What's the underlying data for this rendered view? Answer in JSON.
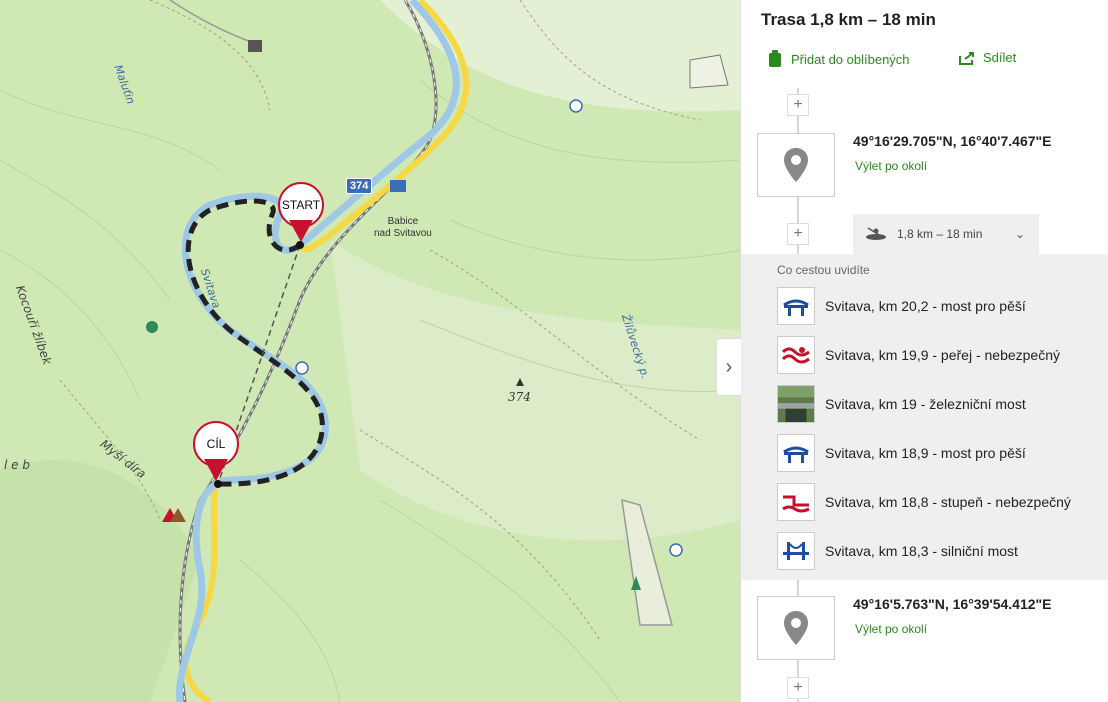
{
  "route": {
    "title": "Trasa 1,8 km – 18 min",
    "favorite_label": "Přidat do oblíbených",
    "share_label": "Sdílet",
    "start": {
      "coord": "49°16'29.705\"N, 16°40'7.467\"E",
      "sub": "Výlet po okolí"
    },
    "end": {
      "coord": "49°16'5.763\"N, 16°39'54.412\"E",
      "sub": "Výlet po okolí"
    },
    "segment": {
      "label": "1,8 km – 18 min",
      "icon": "kayak-icon"
    },
    "poi_heading": "Co cestou uvidíte",
    "pois": [
      {
        "label": "Svitava, km 20,2 - most pro pěší",
        "icon": "footbridge-icon"
      },
      {
        "label": "Svitava, km 19,9 - peřej - nebezpečný",
        "icon": "rapids-icon"
      },
      {
        "label": "Svitava, km 19 - železniční most",
        "icon": "photo-railway-bridge"
      },
      {
        "label": "Svitava, km 18,9 - most pro pěší",
        "icon": "footbridge-icon"
      },
      {
        "label": "Svitava, km 18,8 - stupeň - nebezpečný",
        "icon": "weir-icon"
      },
      {
        "label": "Svitava, km 18,3 - silniční most",
        "icon": "road-bridge-icon"
      }
    ]
  },
  "map": {
    "markers": {
      "start": "START",
      "end": "CÍL"
    },
    "labels": {
      "road_number": "374",
      "town": "Babice\nnad Svitavou",
      "river": "Svitava",
      "stream_top": "Maluťin",
      "stream_right": "Žilůvecký p.",
      "valley": "Kocouří žlíbek",
      "place": "Myší díra",
      "partial": "l  e  b",
      "spot_height": "374"
    },
    "colors": {
      "route": "#222222",
      "marker": "#c8102e",
      "accent": "#2b8a1f",
      "road": "#f5d842"
    }
  }
}
